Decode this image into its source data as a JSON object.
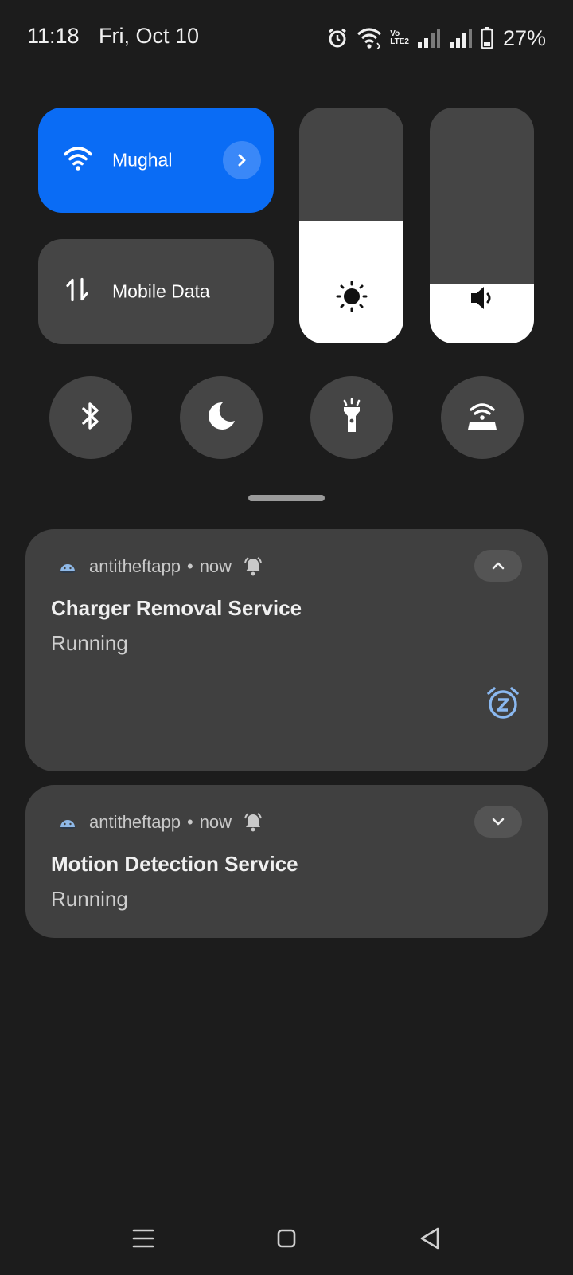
{
  "status_bar": {
    "time": "11:18",
    "date": "Fri, Oct 10",
    "volte_top": "Vo",
    "volte_bottom": "LTE2",
    "battery_pct": "27%",
    "icons": [
      "alarm-icon",
      "wifi-icon",
      "volte-icon",
      "signal-icon",
      "signal-icon",
      "battery-icon"
    ]
  },
  "quick_settings": {
    "wifi_tile": {
      "label": "Mughal",
      "active": true,
      "icon": "wifi-icon",
      "color": "#0a6cf5"
    },
    "data_tile": {
      "label": "Mobile Data",
      "active": false,
      "icon": "data-arrows-icon"
    },
    "brightness_level": 0.52,
    "volume_level": 0.25,
    "toggles": [
      {
        "name": "bluetooth",
        "icon": "bluetooth-icon"
      },
      {
        "name": "dark-mode",
        "icon": "moon-icon"
      },
      {
        "name": "flashlight",
        "icon": "flashlight-icon"
      },
      {
        "name": "hotspot",
        "icon": "hotspot-icon"
      }
    ]
  },
  "notifications": [
    {
      "app": "antitheftapp",
      "separator": "•",
      "time": "now",
      "title": "Charger Removal Service",
      "text": "Running",
      "expanded": true
    },
    {
      "app": "antitheftapp",
      "separator": "•",
      "time": "now",
      "title": "Motion Detection Service",
      "text": "Running",
      "expanded": false
    }
  ],
  "colors": {
    "background": "#1c1c1c",
    "tile": "#454545",
    "card": "#404040",
    "accent": "#0a6cf5",
    "snooze": "#8ab8f0"
  }
}
